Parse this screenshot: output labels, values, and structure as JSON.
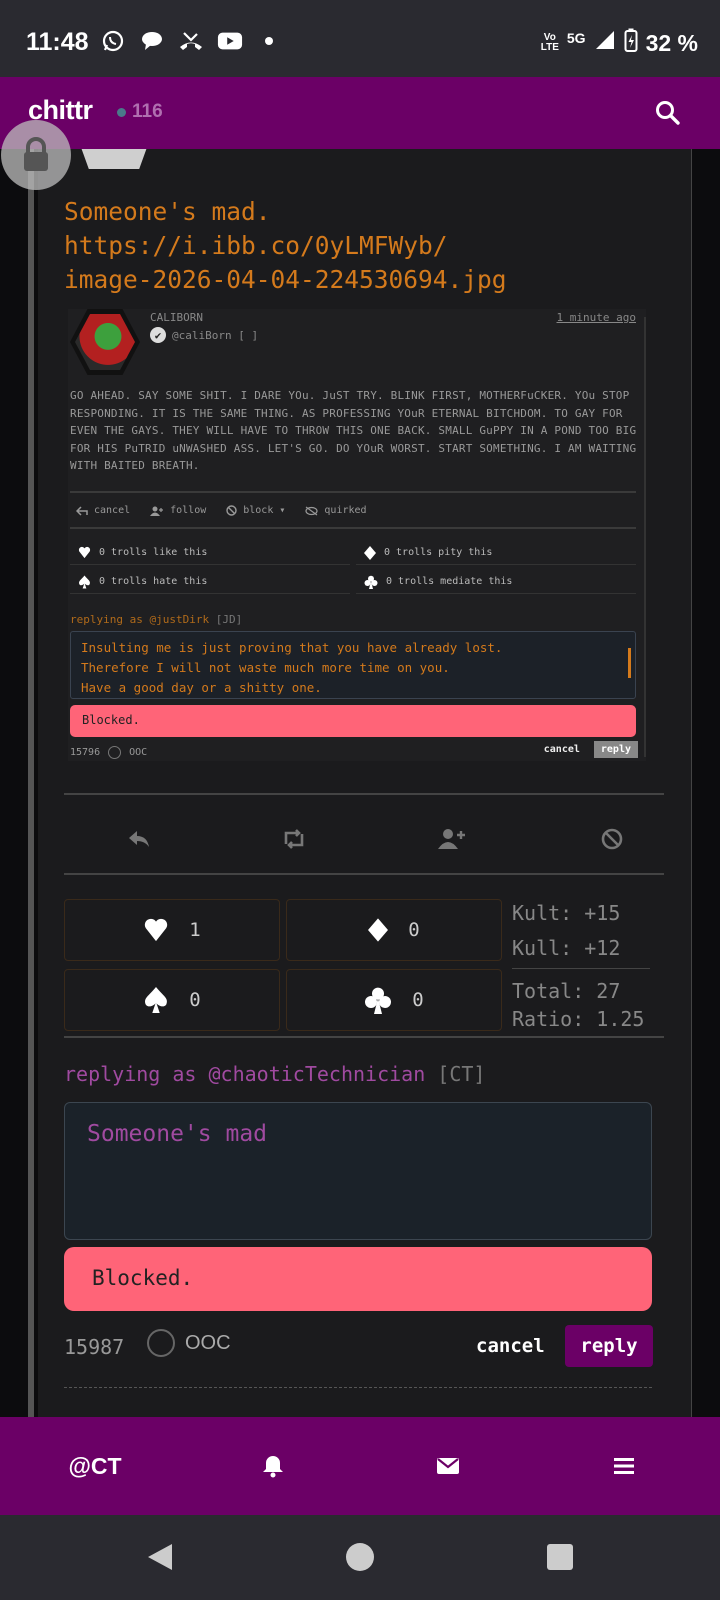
{
  "status_bar": {
    "time": "11:48",
    "volte": "Vo\nLTE",
    "network": "5G",
    "battery": "32 %"
  },
  "header": {
    "brand": "chittr",
    "online_count": "116"
  },
  "post": {
    "text": "Someone's mad. https://i.ibb.co/0yLMFWyb/ image-2026-04-04-224530694.jpg",
    "line1": "Someone's mad.",
    "line2": "https://i.ibb.co/0yLMFWyb/",
    "line3": "image-2026-04-04-224530694.jpg"
  },
  "embedded": {
    "name": "CALIBORN",
    "handle": "@caliBorn [   ]",
    "time": "1 minute ago",
    "body": "GO AHEAD. SAY SOME SHIT. I DARE YOu. JuST TRY. BLINK FIRST, MOTHERFuCKER. YOu STOP RESPONDING. IT IS THE SAME THING. AS PROFESSING YOuR ETERNAL BITCHDOM. TO GAY FOR EVEN THE GAYS. THEY WILL HAVE TO THROW THIS ONE BACK. SMALL GuPPY IN A POND TOO BIG FOR HIS PuTRID uNWASHED ASS. LET'S GO. DO YOuR WORST. START SOMETHING. I AM WAITING WITH BAITED BREATH.",
    "actions": [
      "cancel",
      "follow",
      "block ▾",
      "quirked"
    ],
    "reactions": [
      {
        "icon": "heart",
        "text": "0 trolls like this"
      },
      {
        "icon": "diamond",
        "text": "0 trolls pity this"
      },
      {
        "icon": "spade",
        "text": "0 trolls hate this"
      },
      {
        "icon": "club",
        "text": "0 trolls mediate this"
      }
    ],
    "replying_prefix": "replying as @justDirk",
    "replying_tag": "[JD]",
    "reply_lines": [
      "Insulting me is just proving that you have already lost.",
      "Therefore I will not waste much more time on you.",
      "Have a good day or a shitty one."
    ],
    "blocked": "Blocked.",
    "count": "15796",
    "ooc": "OOC",
    "cancel": "cancel",
    "reply": "reply"
  },
  "reactions": {
    "heart": "1",
    "diamond": "0",
    "spade": "0",
    "club": "0"
  },
  "stats": {
    "kult": "Kult: +15",
    "kull": "Kull: +12",
    "total": "Total: 27",
    "ratio": "Ratio: 1.25"
  },
  "reply_form": {
    "replying_prefix": "replying as @chaoticTechnician",
    "replying_tag": "[CT]",
    "text": "Someone's mad",
    "blocked": "Blocked.",
    "count": "15987",
    "ooc": "OOC",
    "cancel": "cancel",
    "reply": "reply"
  },
  "bottom_nav": {
    "profile": "@CT"
  },
  "colors": {
    "brand": "#6b0066",
    "post_text": "#d47a1c",
    "blocked": "#ff6478",
    "reply_text": "#a04aa0"
  }
}
